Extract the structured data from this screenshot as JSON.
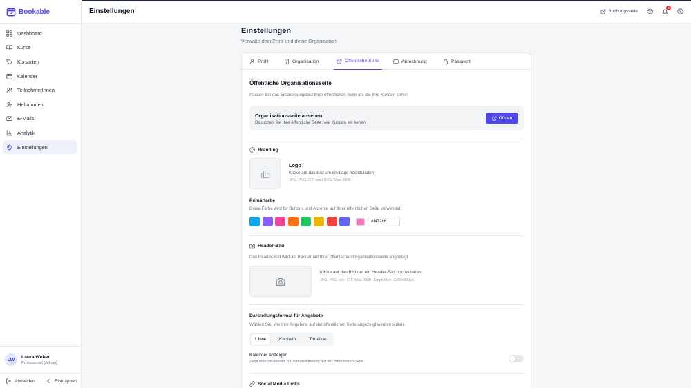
{
  "app": {
    "name": "Bookable"
  },
  "sidebar": {
    "items": [
      {
        "label": "Dashboard",
        "icon": "grid-icon"
      },
      {
        "label": "Kurse",
        "icon": "book-icon"
      },
      {
        "label": "Kursarten",
        "icon": "tag-icon"
      },
      {
        "label": "Kalender",
        "icon": "calendar-icon"
      },
      {
        "label": "TeilnehmerInnen",
        "icon": "users-icon"
      },
      {
        "label": "Hebammen",
        "icon": "user-check-icon"
      },
      {
        "label": "E-Mails",
        "icon": "mail-icon"
      },
      {
        "label": "Analytik",
        "icon": "chart-icon"
      },
      {
        "label": "Einstellungen",
        "icon": "gear-icon",
        "active": true
      }
    ],
    "user": {
      "initials": "LW",
      "name": "Laura Weber",
      "role": "Professional (Admin)"
    },
    "logout_label": "Abmelden",
    "collapse_label": "Einklappen"
  },
  "header": {
    "title": "Einstellungen",
    "booking_link": "Buchungsseite",
    "notification_count": "3"
  },
  "page": {
    "title": "Einstellungen",
    "subtitle": "Verwalte dein Profil und deine Organisation"
  },
  "tabs": [
    {
      "label": "Profil",
      "icon": "user-icon"
    },
    {
      "label": "Organisation",
      "icon": "building-icon"
    },
    {
      "label": "Öffentliche Seite",
      "icon": "external-link-icon",
      "active": true
    },
    {
      "label": "Abrechnung",
      "icon": "credit-card-icon"
    },
    {
      "label": "Passwort",
      "icon": "lock-icon"
    }
  ],
  "public_page": {
    "title": "Öffentliche Organisationsseite",
    "description": "Passen Sie das Erscheinungsbild Ihrer öffentlichen Seite an, die Ihre Kunden sehen",
    "view_title": "Organisationsseite ansehen",
    "view_description": "Besuchen Sie Ihre öffentliche Seite, wie Kunden sie sehen",
    "open_button": "Öffnen"
  },
  "branding": {
    "title": "Branding",
    "logo_title": "Logo",
    "logo_description": "Klicke auf das Bild um ein Logo hochzuladen",
    "logo_hint": "JPG, PNG, GIF oder SVG. Max. 5MB",
    "primary_color_title": "Primärfarbe",
    "primary_color_description": "Diese Farbe wird für Buttons und Akzente auf Ihrer öffentlichen Seite verwendet.",
    "swatches": [
      "#0ea5e9",
      "#8b5cf6",
      "#ec4899",
      "#f97316",
      "#22c55e",
      "#eab308",
      "#ef4444",
      "#6366f1"
    ],
    "current_color": "#f472b6",
    "hex_value": "#f472b6"
  },
  "header_image": {
    "title": "Header-Bild",
    "description": "Das Header-Bild wird als Banner auf Ihrer öffentlichen Organisationsseite angezeigt.",
    "upload_text": "Klicke auf das Bild um ein Header-Bild hochzuladen",
    "upload_hint": "JPG, PNG oder GIF. Max. 5MB. Empfohlen: 1200x300px."
  },
  "display_format": {
    "title": "Darstellungsformat für Angebote",
    "description": "Wählen Sie, wie Ihre Angebote auf der öffentlichen Seite angezeigt werden sollen.",
    "options": [
      "Liste",
      "Kacheln",
      "Timeline"
    ],
    "selected": "Liste"
  },
  "calendar": {
    "title": "Kalender anzeigen",
    "description": "Zeigt einen Kalender zur Datumsfilterung auf der öffentlichen Seite",
    "enabled": false
  },
  "social": {
    "title": "Social Media Links"
  },
  "colors": {
    "accent": "#4f46e5"
  }
}
